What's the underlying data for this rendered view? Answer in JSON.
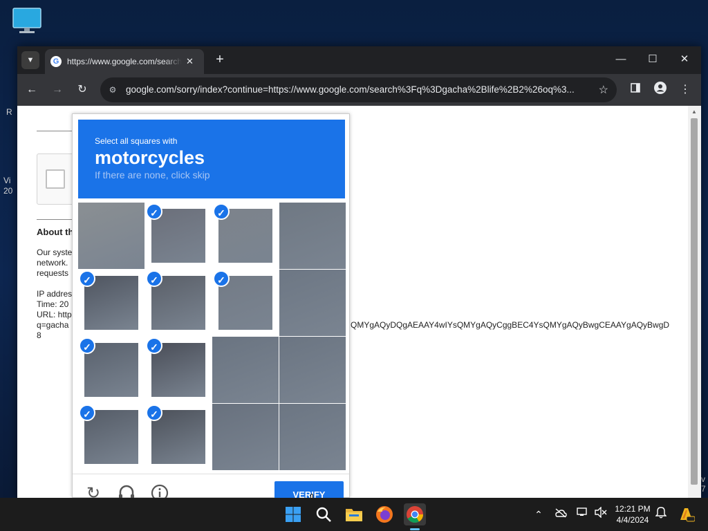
{
  "desktop": {
    "edge_text": {
      "r": "R",
      "vi": "Vi",
      "twenty": "20",
      "v": "v",
      "seven": "7"
    }
  },
  "browser": {
    "tab": {
      "title": "https://www.google.com/search?q=gacha",
      "close": "✕"
    },
    "new_tab": "+",
    "window_controls": {
      "minimize": "—",
      "maximize": "☐",
      "close": "✕"
    },
    "nav": {
      "back": "←",
      "forward": "→",
      "reload": "↻"
    },
    "address_bar": {
      "url": "google.com/sorry/index?continue=https://www.google.com/search%3Fq%3Dgacha%2Blife%2B2%26oq%3..."
    }
  },
  "page": {
    "about": "About th",
    "body_lines": [
      "Our syste",
      "network.",
      "requests"
    ],
    "ip": "IP addres",
    "time": "Time: 20",
    "url_label": "URL: http",
    "url_q": "q=gacha",
    "url_tail": "QMYgAQyDQgAEAAY4wIYsQMYgAQyCggBEC4YsQMYgAQyBwgCEAAYgAQyBwgD",
    "url_end": "8"
  },
  "captcha": {
    "instruction": "Select all squares with",
    "target": "motorcycles",
    "hint": "If there are none, click skip",
    "tiles": [
      {
        "selected": false,
        "color": "#8a8f93"
      },
      {
        "selected": true,
        "color": "#6b6f7a"
      },
      {
        "selected": true,
        "color": "#7d838b"
      },
      {
        "selected": false,
        "color": "#6f7883"
      },
      {
        "selected": true,
        "color": "#4f5560"
      },
      {
        "selected": true,
        "color": "#5a5f68"
      },
      {
        "selected": true,
        "color": "#737b86"
      },
      {
        "selected": false,
        "color": "#6d7784"
      },
      {
        "selected": true,
        "color": "#59616d"
      },
      {
        "selected": true,
        "color": "#4a4e58"
      },
      {
        "selected": false,
        "color": "#6a7481"
      },
      {
        "selected": false,
        "color": "#6b7582"
      },
      {
        "selected": true,
        "color": "#555c67"
      },
      {
        "selected": true,
        "color": "#4c515a"
      },
      {
        "selected": false,
        "color": "#68717e"
      },
      {
        "selected": false,
        "color": "#6c7683"
      }
    ],
    "verify_label": "VERIFY"
  },
  "taskbar": {
    "clock_time": "12:21 PM",
    "clock_date": "4/4/2024",
    "chevron": "⌃"
  }
}
